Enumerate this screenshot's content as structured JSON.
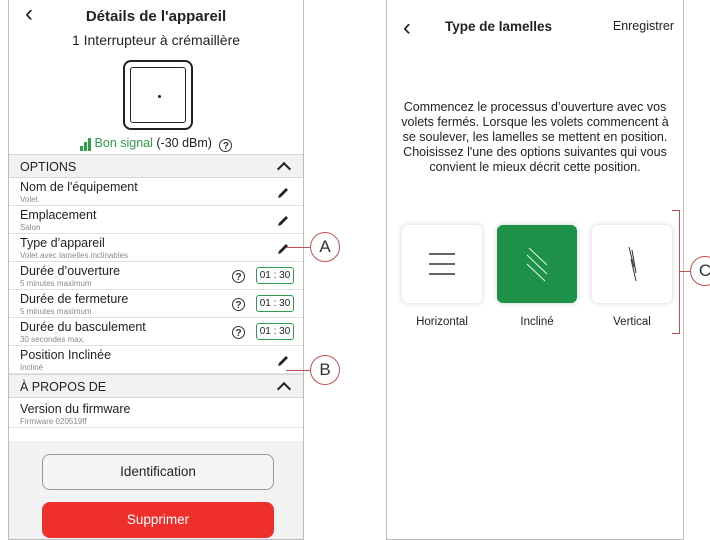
{
  "left_screen": {
    "back_icon": "chevron-left-icon",
    "title": "Détails de l'appareil",
    "subtitle": "1 Interrupteur à crémaillère",
    "signal": {
      "icon": "signal-bars-icon",
      "text": "Bon signal",
      "value": "(-30 dBm)",
      "help_icon": "question-circle-icon",
      "color": "#2e9e48"
    },
    "options_header": "OPTIONS",
    "rows": [
      {
        "title": "Nom de l'équipement",
        "subtitle": "Volet",
        "action": "pencil-icon"
      },
      {
        "title": "Emplacement",
        "subtitle": "Salon",
        "action": "pencil-icon"
      },
      {
        "title": "Type d’appareil",
        "subtitle": "Volet avec lamelles inclinables",
        "action": "pencil-icon"
      },
      {
        "title": "Durée d’ouverture",
        "subtitle": "5 minutes maximum",
        "time": "01 : 30"
      },
      {
        "title": "Durée de fermeture",
        "subtitle": "5 minutes maximum",
        "time": "01 : 30"
      },
      {
        "title": "Durée du basculement",
        "subtitle": "30 secondes max.",
        "time": "01 : 30"
      },
      {
        "title": "Position Inclinée",
        "subtitle": "Incliné",
        "action": "pencil-icon"
      }
    ],
    "about_header": "À PROPOS DE",
    "firmware": {
      "title": "Version du firmware",
      "subtitle": "Firmware 020519ff"
    },
    "identification_label": "Identification",
    "delete_label": "Supprimer",
    "delete_color": "#ef2f2b"
  },
  "right_screen": {
    "back_icon": "chevron-left-icon",
    "title": "Type de lamelles",
    "save_label": "Enregistrer",
    "description": "Commencez le processus d’ouverture avec vos volets fermés. Lorsque les volets commencent à se soulever, les lamelles se mettent en position. Choisissez l'une des options suivantes qui vous convient le mieux décrit cette position.",
    "options": [
      {
        "label": "Horizontal",
        "icon": "horizontal-slats-icon",
        "selected": false
      },
      {
        "label": "Incliné",
        "icon": "tilted-slats-icon",
        "selected": true
      },
      {
        "label": "Vertical",
        "icon": "vertical-slats-icon",
        "selected": false
      }
    ],
    "accent_color": "#1e9149"
  },
  "callouts": {
    "a": "A",
    "b": "B",
    "c": "C"
  }
}
